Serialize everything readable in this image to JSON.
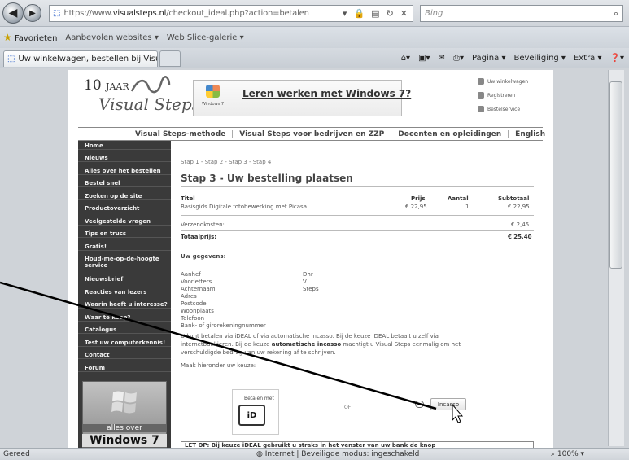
{
  "browser": {
    "url_prefix": "https://www.",
    "url_domain": "visualsteps.nl",
    "url_path": "/checkout_ideal.php?action=betalen",
    "search_placeholder": "Bing",
    "favorites_label": "Favorieten",
    "fav_links": [
      "Aanbevolen websites ▾",
      "Web Slice-galerie ▾"
    ],
    "tab_title": "Uw winkelwagen, bestellen bij Visual ...",
    "commands": [
      "Pagina ▾",
      "Beveiliging ▾",
      "Extra ▾"
    ],
    "status_left": "Gereed",
    "status_center": "Internet | Beveiligde modus: ingeschakeld",
    "zoom": "100%"
  },
  "header": {
    "logo_top": "10",
    "logo_top_small": "JAAR",
    "logo_name": "Visual Steps",
    "banner_link": "Leren werken met Windows 7?",
    "banner_tag": "Windows 7",
    "header_links": [
      "Uw winkelwagen",
      "Registreren",
      "Bestelservice"
    ]
  },
  "nav": [
    "Visual Steps-methode",
    "Visual Steps voor bedrijven en ZZP",
    "Docenten en opleidingen",
    "English"
  ],
  "sidebar": [
    "Home",
    "Nieuws",
    "Alles over het bestellen",
    "Bestel snel",
    "Zoeken op de site",
    "Productoverzicht",
    "Veelgestelde vragen",
    "Tips en trucs",
    "Gratis!",
    "Houd-me-op-de-hoogte service",
    "Nieuwsbrief",
    "Reacties van lezers",
    "Waarin heeft u interesse?",
    "Waar te koop?",
    "Catalogus",
    "Test uw computerkennis!",
    "Contact",
    "Forum"
  ],
  "promo": {
    "line1": "alles over",
    "line2": "Windows 7"
  },
  "content": {
    "steps": "Stap 1 - Stap 2 - Stap 3 - Stap 4",
    "title": "Stap 3 - Uw bestelling plaatsen",
    "table_headers": [
      "Titel",
      "Prijs",
      "Aantal",
      "Subtotaal"
    ],
    "row": {
      "title": "Basisgids Digitale fotobewerking met Picasa",
      "price": "€ 22,95",
      "qty": "1",
      "subtotal": "€ 22,95"
    },
    "shipping_label": "Verzendkosten:",
    "shipping_value": "€ 2,45",
    "total_label": "Totaalprijs:",
    "total_value": "€ 25,40",
    "details_heading": "Uw gegevens:",
    "fields": [
      {
        "label": "Aanhef",
        "value": "Dhr"
      },
      {
        "label": "Voorletters",
        "value": "V"
      },
      {
        "label": "Achternaam",
        "value": "Steps"
      },
      {
        "label": "Adres",
        "value": ""
      },
      {
        "label": "Postcode",
        "value": ""
      },
      {
        "label": "Woonplaats",
        "value": ""
      },
      {
        "label": "Telefoon",
        "value": ""
      },
      {
        "label": "Bank- of girorekeningnummer",
        "value": ""
      }
    ],
    "para1": "U kunt betalen via iDEAL of via automatische incasso. Bij de keuze iDEAL betaalt u zelf via",
    "para2_a": "internetbankieren. Bij de keuze ",
    "para2_b": "automatische incasso",
    "para2_c": " machtigt u Visual Steps eenmalig om het",
    "para3": "verschuldigde bedrag van uw rekening af te schrijven.",
    "choose": "Maak hieronder uw keuze:",
    "pay_with": "Betalen met",
    "ideal": "iD",
    "or": "OF",
    "incasso_button": "Incasso",
    "notice": "LET OP: Bij keuze iDEAL gebruikt u straks in het venster van uw bank de knop"
  }
}
